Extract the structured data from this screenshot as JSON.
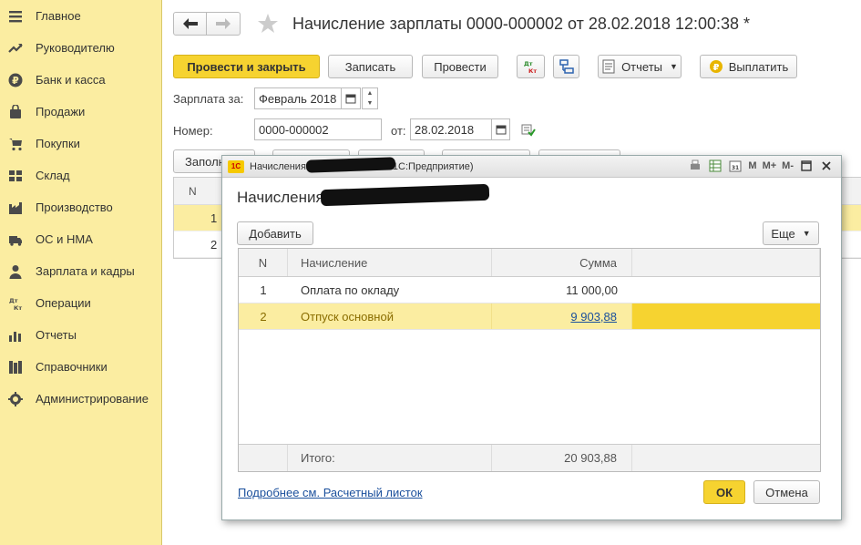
{
  "sidebar": {
    "items": [
      {
        "label": "Главное",
        "icon": "menu-icon"
      },
      {
        "label": "Руководителю",
        "icon": "trend-icon"
      },
      {
        "label": "Банк и касса",
        "icon": "ruble-icon"
      },
      {
        "label": "Продажи",
        "icon": "bag-icon"
      },
      {
        "label": "Покупки",
        "icon": "cart-icon"
      },
      {
        "label": "Склад",
        "icon": "warehouse-icon"
      },
      {
        "label": "Производство",
        "icon": "factory-icon"
      },
      {
        "label": "ОС и НМА",
        "icon": "truck-icon"
      },
      {
        "label": "Зарплата и кадры",
        "icon": "person-icon"
      },
      {
        "label": "Операции",
        "icon": "dt-kt-icon"
      },
      {
        "label": "Отчеты",
        "icon": "bar-chart-icon"
      },
      {
        "label": "Справочники",
        "icon": "books-icon"
      },
      {
        "label": "Администрирование",
        "icon": "gear-icon"
      }
    ]
  },
  "document": {
    "title": "Начисление зарплаты 0000-000002 от 28.02.2018 12:00:38 *"
  },
  "toolbar": {
    "post_close": "Провести и закрыть",
    "save": "Записать",
    "post": "Провести",
    "reports": "Отчеты",
    "pay": "Выплатить",
    "dtkt_icon_text": "Дт Кт"
  },
  "form": {
    "salary_for_label": "Зарплата за:",
    "salary_for_value": "Февраль 2018",
    "number_label": "Номер:",
    "number_value": "0000-000002",
    "from_label": "от:",
    "date_value": "28.02.2018"
  },
  "bg_table": {
    "tab_fill": "Заполн",
    "n_header": "N",
    "rows": [
      "1",
      "2"
    ]
  },
  "modal": {
    "window_title_start": "Начисления",
    "window_title_end": "1С:Предприятие)",
    "heading": "Начисления",
    "add_button": "Добавить",
    "more_button": "Еще",
    "columns": {
      "n": "N",
      "name": "Начисление",
      "sum": "Сумма"
    },
    "rows": [
      {
        "n": "1",
        "name": "Оплата по окладу",
        "sum": "11 000,00"
      },
      {
        "n": "2",
        "name": "Отпуск основной",
        "sum": "9 903,88"
      }
    ],
    "total_label": "Итого:",
    "total_value": "20 903,88",
    "detail_link": "Подробнее см. Расчетный листок",
    "ok": "ОК",
    "cancel": "Отмена",
    "tb_m": "M",
    "tb_mplus": "M+",
    "tb_mminus": "M-"
  },
  "colors": {
    "sidebar_bg": "#fbeda1",
    "accent_yellow": "#f6d330",
    "link_blue": "#1a4f9c"
  }
}
